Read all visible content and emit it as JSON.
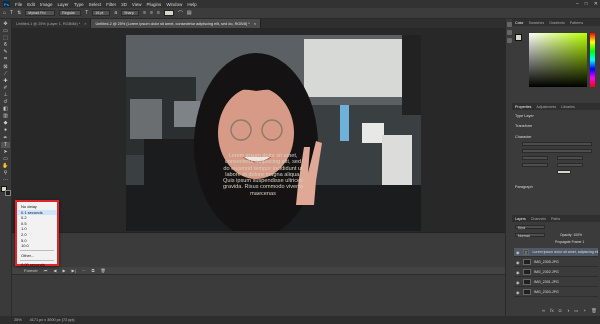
{
  "app": {
    "menu": [
      "File",
      "Edit",
      "Image",
      "Layer",
      "Type",
      "Select",
      "Filter",
      "3D",
      "View",
      "Plugins",
      "Window",
      "Help"
    ]
  },
  "options": {
    "font_size": "Myriad Pro",
    "font_style": "Regular",
    "size": "16 pt",
    "aa": "Sharp",
    "colors": {
      "swatch": "#d6d6c8"
    }
  },
  "tabs": [
    {
      "label": "Untitled-1 @ 25% (Layer 1, RGB/8#) *",
      "active": false
    },
    {
      "label": "Untitled-2 @ 25% (Lorem ipsum dolor sit amet, consectetur adipiscing elit, sed do, RGB/8) *",
      "active": true
    }
  ],
  "photo": {
    "overlay_text": "Lorem ipsum dolor sit amet, consectetur adipiscing elit, sed do eiusmod tempor incididunt ut labore et dolore magna aliqua. Quis ipsum suspendisse ultrices gravida. Risus commodo viverra maecenas"
  },
  "delay_menu": {
    "items": [
      "No delay",
      "0.1 seconds",
      "0.2",
      "0.5",
      "1.0",
      "2.0",
      "5.0",
      "10.0"
    ],
    "other": "Other...",
    "current": "0.00 seconds",
    "selected_index": 1
  },
  "timeline": {
    "loop": "Forever"
  },
  "status": {
    "zoom": "25%",
    "doc": "4171 px x 3000 px (72 ppi)"
  },
  "color_panel": {
    "tabs": [
      "Color",
      "Swatches",
      "Gradients",
      "Patterns"
    ]
  },
  "properties": {
    "tabs": [
      "Properties",
      "Adjustments",
      "Libraries"
    ],
    "kind": "Type Layer",
    "sections": [
      "Transform",
      "Character",
      "Paragraph"
    ]
  },
  "layers_panel": {
    "tabs": [
      "Layers",
      "Channels",
      "Paths"
    ],
    "filter": "Kind",
    "blend": "Normal",
    "opacity": "Opacity: 100%",
    "propagate": "Propagate Frame 1",
    "layers": [
      {
        "name": "Lorem ipsum dolor sit amet, adipiscing elit, sed do",
        "type": "text",
        "active": true
      },
      {
        "name": "IMG_2305.JPG",
        "type": "image",
        "active": false
      },
      {
        "name": "IMG_2302.JPG",
        "type": "image",
        "active": false
      },
      {
        "name": "IMG_2301.JPG",
        "type": "image",
        "active": false
      },
      {
        "name": "IMG_2303.JPG",
        "type": "image",
        "active": false
      }
    ]
  }
}
